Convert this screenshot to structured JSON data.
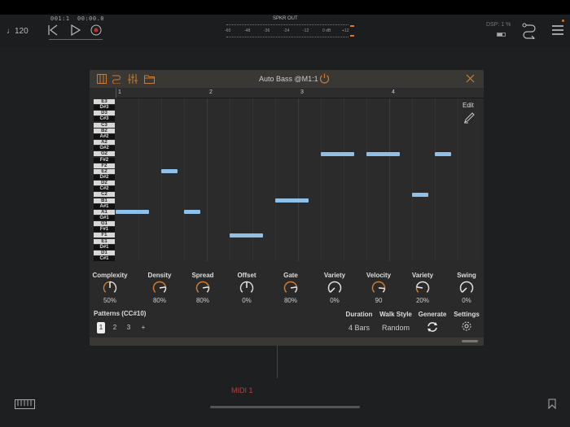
{
  "transport": {
    "tempo": "♩120",
    "position": "001:1",
    "time": "00:00.0",
    "record_color": "#c0302a"
  },
  "meter": {
    "title": "SPKR OUT",
    "scale": [
      "-60",
      "-48",
      "-36",
      "-24",
      "-12",
      "0 dB",
      "+12"
    ]
  },
  "dsp": "DSP: 1 %",
  "plugin": {
    "title": "Auto Bass @M1:1",
    "bars": [
      "1",
      "2",
      "3",
      "4"
    ],
    "edit_label": "Edit",
    "keys": [
      "E3",
      "D#3",
      "D3",
      "C#3",
      "C3",
      "B2",
      "A#2",
      "A2",
      "G#2",
      "G2",
      "F#2",
      "F2",
      "E2",
      "D#2",
      "D2",
      "C#2",
      "C2",
      "B1",
      "A#1",
      "A1",
      "G#1",
      "G1",
      "F#1",
      "F1",
      "E1",
      "D#1",
      "D1",
      "C#1"
    ],
    "notes": [
      {
        "pitch": "A1",
        "start": 0,
        "length": 1.5
      },
      {
        "pitch": "E2",
        "start": 2,
        "length": 0.75
      },
      {
        "pitch": "A1",
        "start": 3,
        "length": 0.75
      },
      {
        "pitch": "F1",
        "start": 5,
        "length": 1.5
      },
      {
        "pitch": "B1",
        "start": 7,
        "length": 1.5
      },
      {
        "pitch": "G2",
        "start": 9,
        "length": 1.5
      },
      {
        "pitch": "G2",
        "start": 11,
        "length": 1.5
      },
      {
        "pitch": "C2",
        "start": 13,
        "length": 0.75
      },
      {
        "pitch": "G2",
        "start": 14,
        "length": 0.75
      }
    ],
    "knobs": [
      {
        "label": "Complexity",
        "value": "50%",
        "level": 0.5,
        "orange": true
      },
      {
        "label": "Density",
        "value": "80%",
        "level": 0.8,
        "orange": true
      },
      {
        "label": "Spread",
        "value": "80%",
        "level": 0.8,
        "orange": true
      },
      {
        "label": "Offset",
        "value": "0%",
        "level": 0.5,
        "orange": false
      },
      {
        "label": "Gate",
        "value": "80%",
        "level": 0.8,
        "orange": true
      },
      {
        "label": "Variety",
        "value": "0%",
        "level": 0.0,
        "orange": false
      },
      {
        "label": "Velocity",
        "value": "90",
        "level": 0.85,
        "orange": true
      },
      {
        "label": "Variety",
        "value": "20%",
        "level": 0.2,
        "orange": true
      },
      {
        "label": "Swing",
        "value": "0%",
        "level": 0.0,
        "orange": false
      }
    ],
    "patterns_label": "Patterns (CC#10)",
    "patterns": [
      "1",
      "2",
      "3",
      "+"
    ],
    "duration": {
      "label": "Duration",
      "value": "4 Bars"
    },
    "walk_style": {
      "label": "Walk Style",
      "value": "Random"
    },
    "generate_label": "Generate",
    "settings_label": "Settings"
  },
  "track_label": "MIDI 1",
  "colors": {
    "accent": "#d07a2c",
    "note": "#8ec0e8"
  }
}
